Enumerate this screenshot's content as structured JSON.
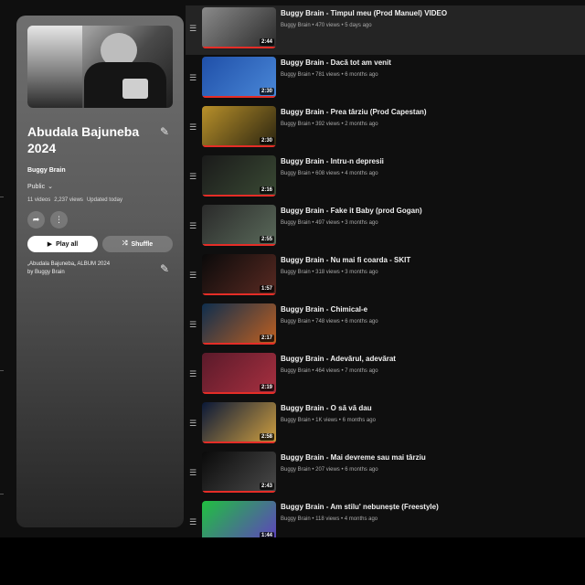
{
  "playlist": {
    "title": "Abudala Bajuneba 2024",
    "owner": "Buggy Brain",
    "privacy": "Public",
    "video_count": "11 videos",
    "views": "2,237 views",
    "updated": "Updated today",
    "play_all_label": "Play all",
    "shuffle_label": "Shuffle",
    "description_line1": "„Abudala Bajuneba„ ALBUM 2024",
    "description_line2": "by Buggy Brain"
  },
  "videos": [
    {
      "title": "Buggy Brain - Timpul meu (Prod Manuel) VIDEO",
      "meta": "Buggy Brain • 470 views • 5 days ago",
      "duration": "2:44",
      "colors": [
        "#8a8a8a",
        "#2a2a2a"
      ]
    },
    {
      "title": "Buggy Brain - Dacă tot am venit",
      "meta": "Buggy Brain • 781 views • 6 months ago",
      "duration": "2:30",
      "colors": [
        "#1f4fa8",
        "#4a88d8"
      ]
    },
    {
      "title": "Buggy Brain - Prea târziu (Prod Capestan)",
      "meta": "Buggy Brain • 392 views • 2 months ago",
      "duration": "2:30",
      "colors": [
        "#b8902a",
        "#2a2410"
      ]
    },
    {
      "title": "Buggy Brain - Intru-n depresii",
      "meta": "Buggy Brain • 608 views • 4 months ago",
      "duration": "2:16",
      "colors": [
        "#1a1a1a",
        "#3a4a34"
      ]
    },
    {
      "title": "Buggy Brain - Fake it Baby (prod Gogan)",
      "meta": "Buggy Brain • 497 views • 3 months ago",
      "duration": "2:55",
      "colors": [
        "#2a2a2a",
        "#5a6a5a"
      ]
    },
    {
      "title": "Buggy Brain - Nu mai fi coarda - SKIT",
      "meta": "Buggy Brain • 318 views • 3 months ago",
      "duration": "1:57",
      "colors": [
        "#0a0a0a",
        "#5a2a22"
      ]
    },
    {
      "title": "Buggy Brain - Chimical-e",
      "meta": "Buggy Brain • 748 views • 6 months ago",
      "duration": "2:17",
      "colors": [
        "#0e2e4e",
        "#c06020"
      ]
    },
    {
      "title": "Buggy Brain - Adevărul, adevărat",
      "meta": "Buggy Brain • 464 views • 7 months ago",
      "duration": "2:19",
      "colors": [
        "#5a1a2a",
        "#a83040"
      ]
    },
    {
      "title": "Buggy Brain - O să vă dau",
      "meta": "Buggy Brain • 1K views • 6 months ago",
      "duration": "2:58",
      "colors": [
        "#0a1838",
        "#d0a040"
      ]
    },
    {
      "title": "Buggy Brain - Mai devreme sau mai târziu",
      "meta": "Buggy Brain • 207 views • 6 months ago",
      "duration": "2:43",
      "colors": [
        "#0a0a0a",
        "#4a4a4a"
      ]
    },
    {
      "title": "Buggy Brain - Am stilu' nebunește (Freestyle)",
      "meta": "Buggy Brain • 118 views • 4 months ago",
      "duration": "1:44",
      "colors": [
        "#20c040",
        "#6040c0"
      ]
    }
  ]
}
